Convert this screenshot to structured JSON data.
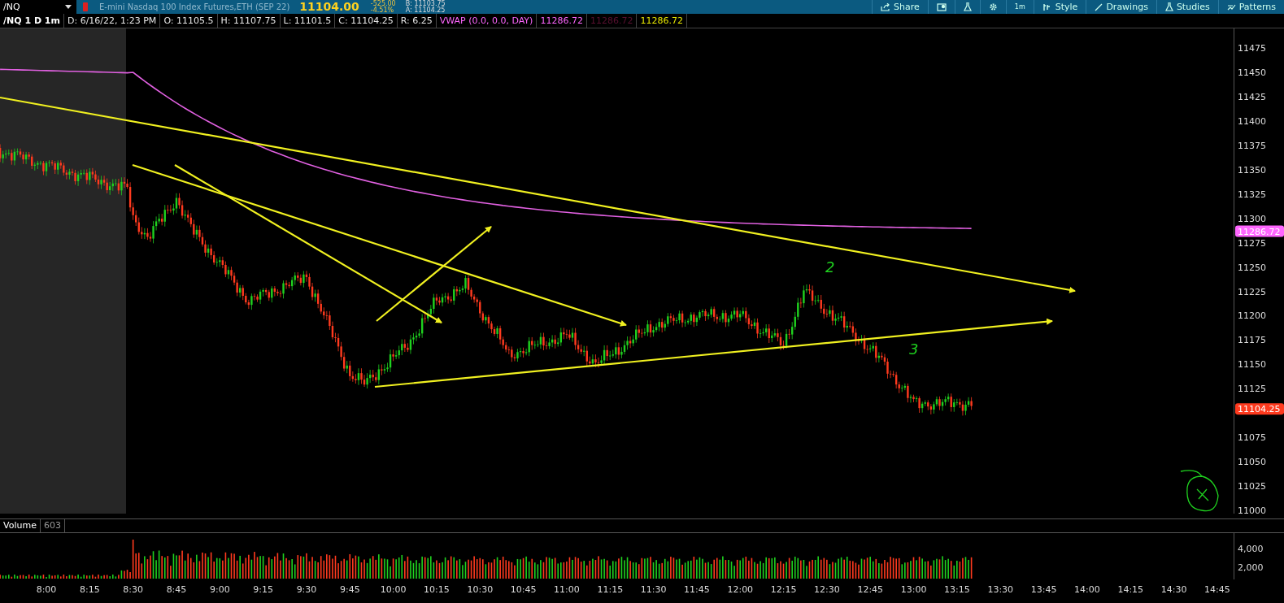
{
  "symbol_bar": {
    "symbol": "/NQ",
    "description": "E-mini Nasdaq 100 Index Futures,ETH (SEP 22)",
    "last": "11104.00",
    "net_change": "-525.00",
    "percent_change": "-4.51%",
    "bid": "B: 11103.75",
    "ask": "A: 11104.25"
  },
  "toolbar": [
    {
      "kind": "share",
      "label": "Share"
    },
    {
      "kind": "alert"
    },
    {
      "kind": "flask"
    },
    {
      "kind": "gear"
    },
    {
      "kind": "text",
      "label": "1m"
    },
    {
      "kind": "style",
      "label": "Style"
    },
    {
      "kind": "drawings",
      "label": "Drawings"
    },
    {
      "kind": "studies",
      "label": "Studies"
    },
    {
      "kind": "patterns",
      "label": "Patterns"
    }
  ],
  "chart_header": [
    {
      "kind": "title",
      "text": "/NQ 1 D 1m"
    },
    {
      "kind": "field",
      "text": "D: 6/16/22, 1:23 PM"
    },
    {
      "kind": "field",
      "text": "O: 11105.5"
    },
    {
      "kind": "field",
      "text": "H: 11107.75"
    },
    {
      "kind": "field",
      "text": "L: 11101.5"
    },
    {
      "kind": "field",
      "text": "C: 11104.25"
    },
    {
      "kind": "field",
      "text": "R: 6.25"
    },
    {
      "kind": "study",
      "text": "VWAP (0.0, 0.0, DAY)",
      "color": "#ff66ff"
    },
    {
      "kind": "study",
      "text": "11286.72",
      "color": "#ff66ff"
    },
    {
      "kind": "study",
      "text": "11286.72",
      "color": "#5a1030"
    },
    {
      "kind": "study",
      "text": "11286.72",
      "color": "#e8e800"
    }
  ],
  "price_axis": {
    "ticks": [
      "11475",
      "11450",
      "11425",
      "11400",
      "11375",
      "11350",
      "11325",
      "11300",
      "11275",
      "11250",
      "11225",
      "11200",
      "11175",
      "11150",
      "11125",
      "11075",
      "11050",
      "11025",
      "11000"
    ],
    "badges": [
      {
        "text": "11286.72",
        "color": "#ff66ff"
      },
      {
        "text": "11104.25",
        "color": "#ff3a1e"
      }
    ]
  },
  "annotations": [
    {
      "text": "2"
    },
    {
      "text": "3"
    }
  ],
  "volume": {
    "label": "Volume",
    "value": "603",
    "ticks": [
      "4,000",
      "2,000"
    ]
  },
  "time_axis": [
    "8:00",
    "8:15",
    "8:30",
    "8:45",
    "9:00",
    "9:15",
    "9:30",
    "9:45",
    "10:00",
    "10:15",
    "10:30",
    "10:45",
    "11:00",
    "11:15",
    "11:30",
    "11:45",
    "12:00",
    "12:15",
    "12:30",
    "12:45",
    "13:00",
    "13:15",
    "13:30",
    "13:45",
    "14:00",
    "14:15",
    "14:30",
    "14:45"
  ]
}
